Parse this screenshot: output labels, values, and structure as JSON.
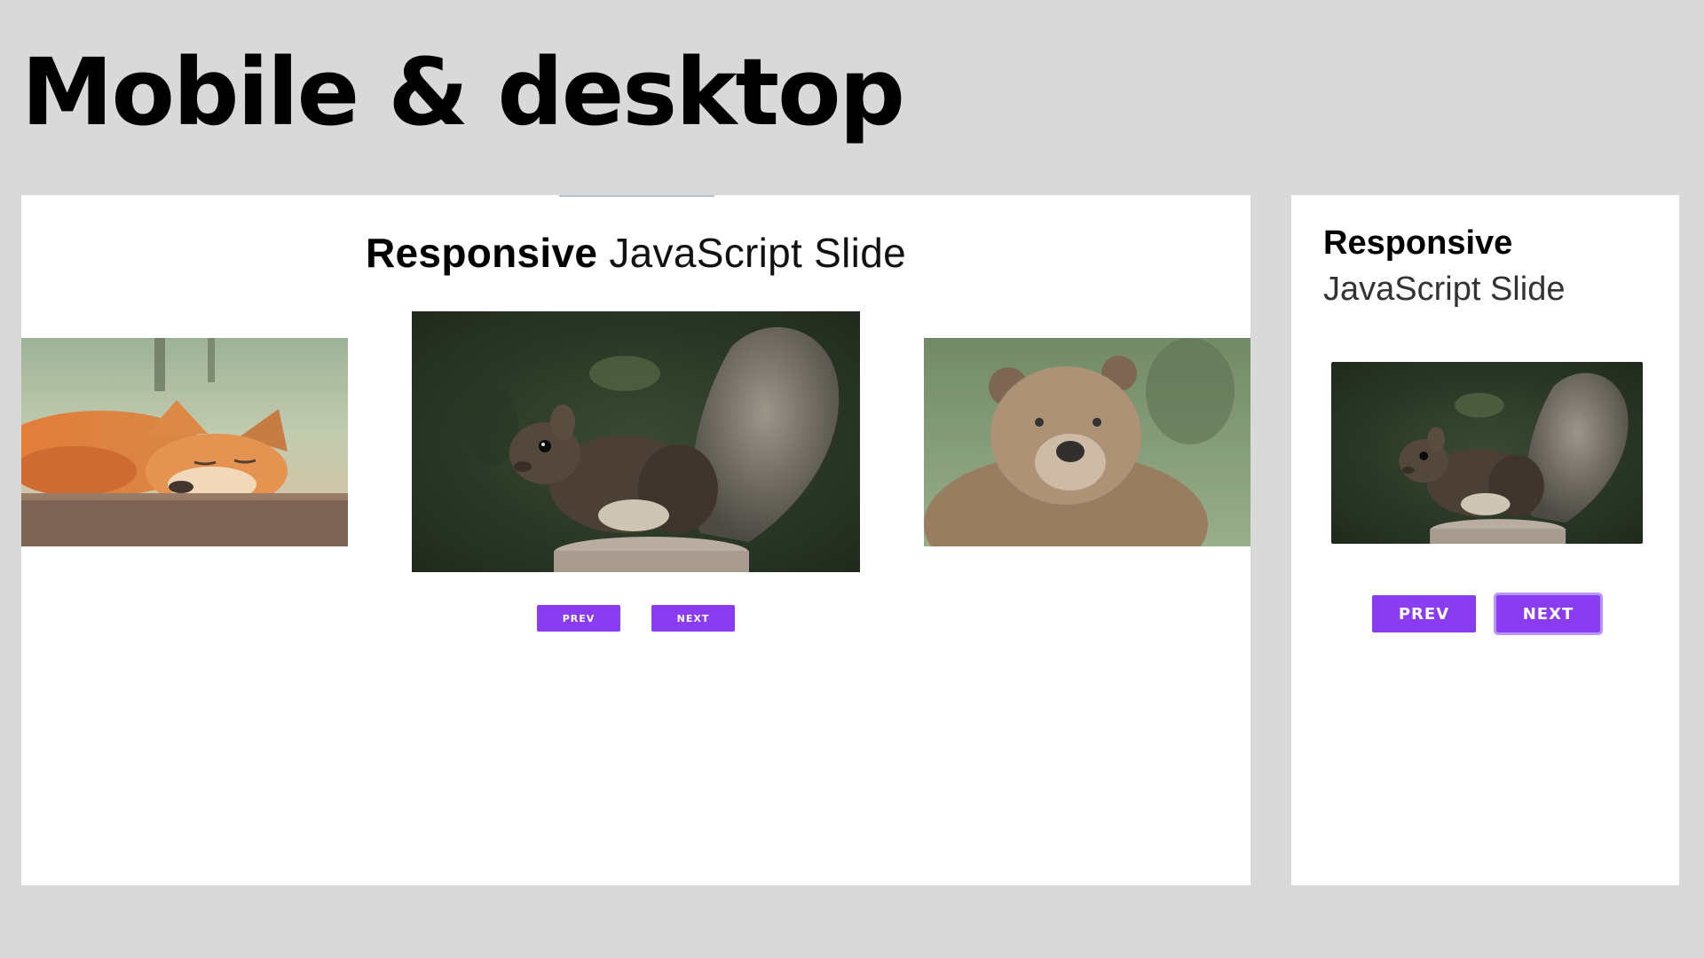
{
  "slide_title": "Mobile & desktop",
  "desktop": {
    "heading_bold": "Responsive",
    "heading_light": "JavaScript Slide",
    "slides": [
      "fox-photo",
      "squirrel-photo",
      "bear-photo"
    ],
    "prev_label": "PREV",
    "next_label": "NEXT"
  },
  "mobile": {
    "heading_bold": "Responsive",
    "heading_light": "JavaScript Slide",
    "slides": [
      "squirrel-photo"
    ],
    "prev_label": "PREV",
    "next_label": "NEXT"
  },
  "colors": {
    "background": "#d9d9d9",
    "panel": "#ffffff",
    "button": "#8a3df0",
    "button_focus_ring": "#b894f7"
  }
}
